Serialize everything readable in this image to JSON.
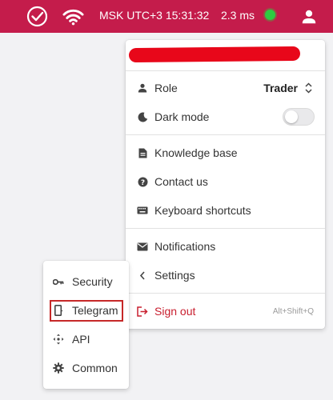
{
  "topbar": {
    "clock": "MSK UTC+3 15:31:32",
    "ping": "2.3 ms",
    "status_color": "#2ecc40",
    "bar_color": "#c41c4b",
    "icons": [
      "check-circle-icon",
      "wifi-icon",
      "status-dot",
      "user-icon"
    ]
  },
  "menu": {
    "role_label": "Role",
    "role_value": "Trader",
    "dark_mode_label": "Dark mode",
    "dark_mode_on": false,
    "knowledge_base_label": "Knowledge base",
    "contact_us_label": "Contact us",
    "keyboard_shortcuts_label": "Keyboard shortcuts",
    "notifications_label": "Notifications",
    "settings_label": "Settings",
    "sign_out_label": "Sign out",
    "sign_out_shortcut": "Alt+Shift+Q",
    "sign_out_color": "#c81e2e"
  },
  "submenu": {
    "items": [
      {
        "label": "Security",
        "icon": "key-icon"
      },
      {
        "label": "Telegram",
        "icon": "telegram-phone-icon",
        "highlighted": true
      },
      {
        "label": "API",
        "icon": "api-icon"
      },
      {
        "label": "Common",
        "icon": "gear-icon"
      }
    ]
  }
}
